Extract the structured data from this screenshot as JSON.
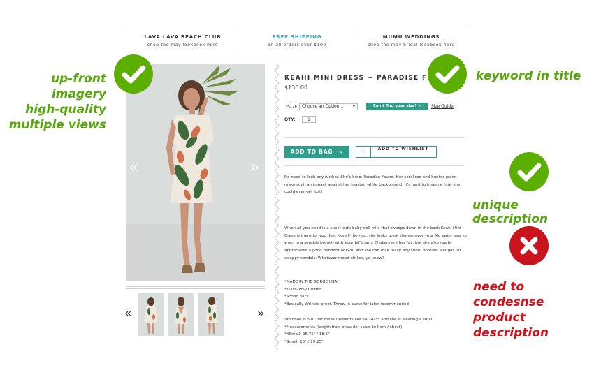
{
  "promo": [
    {
      "title": "LAVA LAVA BEACH CLUB",
      "subtitle": "shop the may lookbook here",
      "accent": "#333333"
    },
    {
      "title": "FREE SHIPPING",
      "subtitle": "on all orders over $100",
      "accent": "#3aa7c7"
    },
    {
      "title": "MUMU WEDDINGS",
      "subtitle": "shop the may bridal lookbook here",
      "accent": "#333333"
    }
  ],
  "product": {
    "title": "KEAHI MINI DRESS ~ PARADISE FOUND",
    "price": "$136.00",
    "size_label": "*SIZE:",
    "size_option": "Choose an Option...",
    "find_size": "Can't find your size? »",
    "size_guide": "Size Guide",
    "qty_label": "QTY:",
    "qty_value": "1",
    "add_to_bag": "ADD TO BAG",
    "add_to_bag_icon": "»",
    "wishlist": "ADD TO WISHLIST",
    "wishlist_icon": "♡"
  },
  "description": {
    "p1": "No need to look any further. She's here: Paradise Found. Her coral red and hunter green make such an impact against her toasted white background. It's hard to imagine how she could ever get lost!",
    "p2": "When all you need is a super cute baby doll mini that swoops down in the back Keahi Mini Dress is there for you. Just like all the rest, she looks great thrown over your Mu swim gear or worn to a seaside brunch with your bff's fam. Chokers are her fav, but she also really appreciates a good pendant or two. And she can rock really any shoe: booties, wedges, or strappy sandals. Whatever mood strikes, ya know?",
    "bullets": [
      "*MADE IN THE GORGE USA*",
      "*100% Poly Chiffon",
      "*Scoop back",
      "*Basically Wrinkle-proof. Throw in purse for later recommended"
    ],
    "measure_intro": "Shannon is 5'8\" her measurements are 34-24-35 and she is wearing a small",
    "measurements": [
      "*Measurements (length from shoulder seam to hem / chest)",
      "*XSmall: 25.75\" / 18.5\"",
      "*Small: 26\" / 19.25\""
    ]
  },
  "gallery": {
    "prev_icon": "«",
    "next_icon": "»",
    "thumb_count": 3
  },
  "annotations": {
    "imagery_1": "up-front imagery",
    "imagery_2": "high-quality",
    "imagery_3": "multiple views",
    "keyword": "keyword in title",
    "unique": "unique description",
    "condense_1": "need to condesnse",
    "condense_2": "product description",
    "check_color": "#5cae00",
    "x_color": "#c8141c"
  }
}
